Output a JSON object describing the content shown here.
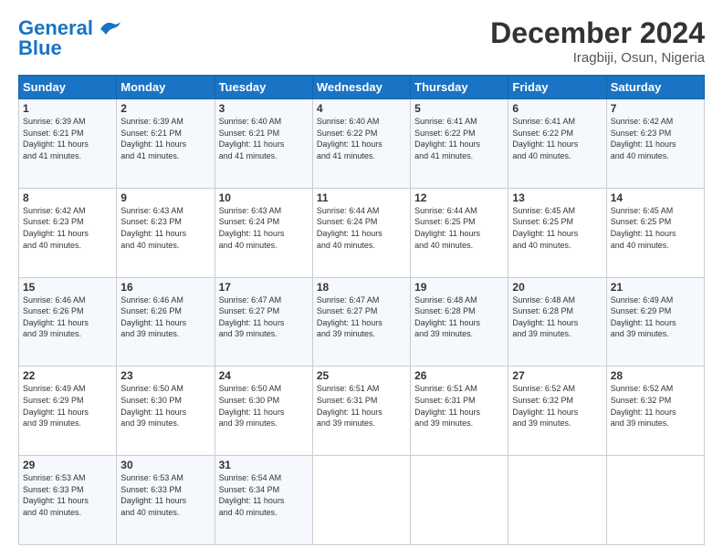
{
  "header": {
    "logo_line1": "General",
    "logo_line2": "Blue",
    "month": "December 2024",
    "location": "Iragbiji, Osun, Nigeria"
  },
  "weekdays": [
    "Sunday",
    "Monday",
    "Tuesday",
    "Wednesday",
    "Thursday",
    "Friday",
    "Saturday"
  ],
  "weeks": [
    [
      {
        "day": "1",
        "info": "Sunrise: 6:39 AM\nSunset: 6:21 PM\nDaylight: 11 hours\nand 41 minutes."
      },
      {
        "day": "2",
        "info": "Sunrise: 6:39 AM\nSunset: 6:21 PM\nDaylight: 11 hours\nand 41 minutes."
      },
      {
        "day": "3",
        "info": "Sunrise: 6:40 AM\nSunset: 6:21 PM\nDaylight: 11 hours\nand 41 minutes."
      },
      {
        "day": "4",
        "info": "Sunrise: 6:40 AM\nSunset: 6:22 PM\nDaylight: 11 hours\nand 41 minutes."
      },
      {
        "day": "5",
        "info": "Sunrise: 6:41 AM\nSunset: 6:22 PM\nDaylight: 11 hours\nand 41 minutes."
      },
      {
        "day": "6",
        "info": "Sunrise: 6:41 AM\nSunset: 6:22 PM\nDaylight: 11 hours\nand 40 minutes."
      },
      {
        "day": "7",
        "info": "Sunrise: 6:42 AM\nSunset: 6:23 PM\nDaylight: 11 hours\nand 40 minutes."
      }
    ],
    [
      {
        "day": "8",
        "info": "Sunrise: 6:42 AM\nSunset: 6:23 PM\nDaylight: 11 hours\nand 40 minutes."
      },
      {
        "day": "9",
        "info": "Sunrise: 6:43 AM\nSunset: 6:23 PM\nDaylight: 11 hours\nand 40 minutes."
      },
      {
        "day": "10",
        "info": "Sunrise: 6:43 AM\nSunset: 6:24 PM\nDaylight: 11 hours\nand 40 minutes."
      },
      {
        "day": "11",
        "info": "Sunrise: 6:44 AM\nSunset: 6:24 PM\nDaylight: 11 hours\nand 40 minutes."
      },
      {
        "day": "12",
        "info": "Sunrise: 6:44 AM\nSunset: 6:25 PM\nDaylight: 11 hours\nand 40 minutes."
      },
      {
        "day": "13",
        "info": "Sunrise: 6:45 AM\nSunset: 6:25 PM\nDaylight: 11 hours\nand 40 minutes."
      },
      {
        "day": "14",
        "info": "Sunrise: 6:45 AM\nSunset: 6:25 PM\nDaylight: 11 hours\nand 40 minutes."
      }
    ],
    [
      {
        "day": "15",
        "info": "Sunrise: 6:46 AM\nSunset: 6:26 PM\nDaylight: 11 hours\nand 39 minutes."
      },
      {
        "day": "16",
        "info": "Sunrise: 6:46 AM\nSunset: 6:26 PM\nDaylight: 11 hours\nand 39 minutes."
      },
      {
        "day": "17",
        "info": "Sunrise: 6:47 AM\nSunset: 6:27 PM\nDaylight: 11 hours\nand 39 minutes."
      },
      {
        "day": "18",
        "info": "Sunrise: 6:47 AM\nSunset: 6:27 PM\nDaylight: 11 hours\nand 39 minutes."
      },
      {
        "day": "19",
        "info": "Sunrise: 6:48 AM\nSunset: 6:28 PM\nDaylight: 11 hours\nand 39 minutes."
      },
      {
        "day": "20",
        "info": "Sunrise: 6:48 AM\nSunset: 6:28 PM\nDaylight: 11 hours\nand 39 minutes."
      },
      {
        "day": "21",
        "info": "Sunrise: 6:49 AM\nSunset: 6:29 PM\nDaylight: 11 hours\nand 39 minutes."
      }
    ],
    [
      {
        "day": "22",
        "info": "Sunrise: 6:49 AM\nSunset: 6:29 PM\nDaylight: 11 hours\nand 39 minutes."
      },
      {
        "day": "23",
        "info": "Sunrise: 6:50 AM\nSunset: 6:30 PM\nDaylight: 11 hours\nand 39 minutes."
      },
      {
        "day": "24",
        "info": "Sunrise: 6:50 AM\nSunset: 6:30 PM\nDaylight: 11 hours\nand 39 minutes."
      },
      {
        "day": "25",
        "info": "Sunrise: 6:51 AM\nSunset: 6:31 PM\nDaylight: 11 hours\nand 39 minutes."
      },
      {
        "day": "26",
        "info": "Sunrise: 6:51 AM\nSunset: 6:31 PM\nDaylight: 11 hours\nand 39 minutes."
      },
      {
        "day": "27",
        "info": "Sunrise: 6:52 AM\nSunset: 6:32 PM\nDaylight: 11 hours\nand 39 minutes."
      },
      {
        "day": "28",
        "info": "Sunrise: 6:52 AM\nSunset: 6:32 PM\nDaylight: 11 hours\nand 39 minutes."
      }
    ],
    [
      {
        "day": "29",
        "info": "Sunrise: 6:53 AM\nSunset: 6:33 PM\nDaylight: 11 hours\nand 40 minutes."
      },
      {
        "day": "30",
        "info": "Sunrise: 6:53 AM\nSunset: 6:33 PM\nDaylight: 11 hours\nand 40 minutes."
      },
      {
        "day": "31",
        "info": "Sunrise: 6:54 AM\nSunset: 6:34 PM\nDaylight: 11 hours\nand 40 minutes."
      },
      null,
      null,
      null,
      null
    ]
  ]
}
